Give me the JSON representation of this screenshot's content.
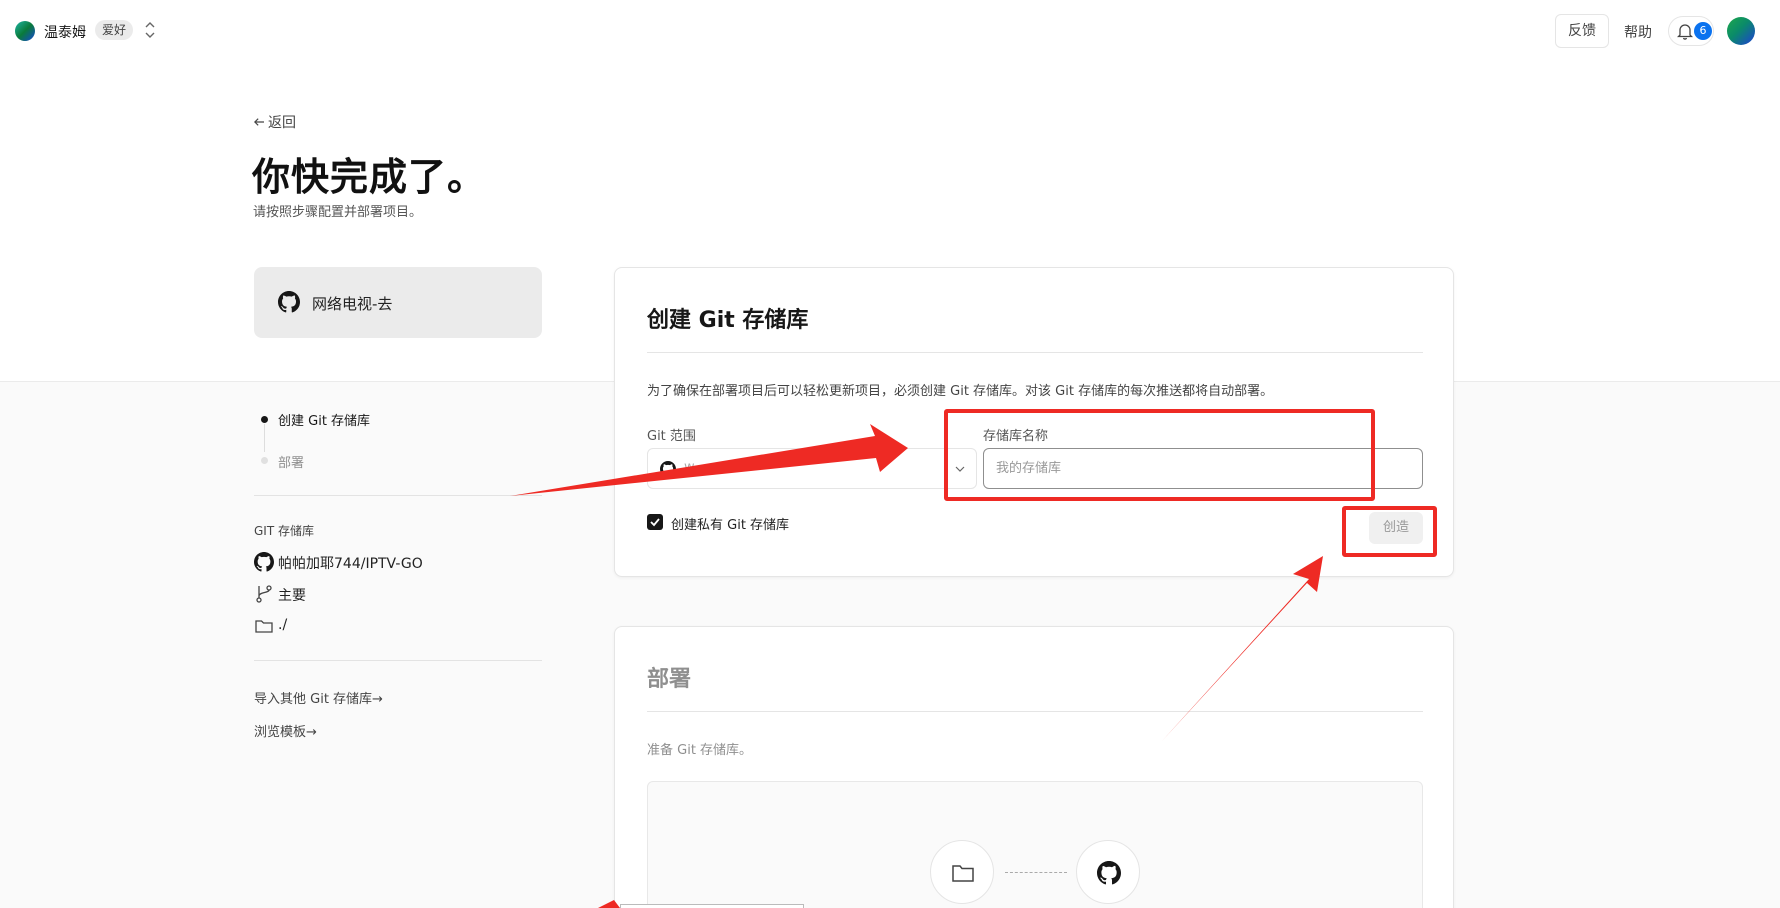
{
  "nav": {
    "team_name": "温泰姆",
    "plan_badge": "爱好",
    "feedback_label": "反馈",
    "help_label": "帮助",
    "notification_count": "6"
  },
  "header": {
    "back_label": "返回",
    "title": "你快完成了。",
    "subtitle": "请按照步骤配置并部署项目。"
  },
  "repo_card": {
    "name": "网络电视-去"
  },
  "steps": [
    {
      "label": "创建 Git 存储库",
      "active": true
    },
    {
      "label": "部署",
      "active": false
    }
  ],
  "git_info": {
    "section_label": "GIT 存储库",
    "repo": "帕帕加耶744/IPTV-GO",
    "branch": "主要",
    "directory": "./"
  },
  "links": {
    "import_other": "导入其他 Git 存储库→",
    "browse_templates": "浏览模板→"
  },
  "create_repo_card": {
    "title": "创建 Git 存储库",
    "description": "为了确保在部署项目后可以轻松更新项目，必须创建 Git 存储库。对该 Git 存储库的每次推送都将自动部署。",
    "scope_label": "Git 范围",
    "scope_value": "w...",
    "name_label": "存储库名称",
    "name_placeholder": "我的存储库",
    "private_label": "创建私有 Git 存储库",
    "private_checked": true,
    "create_button": "创造"
  },
  "deploy_card": {
    "title": "部署",
    "description": "准备 Git 存储库。"
  },
  "colors": {
    "annotation": "#ee2a24",
    "accent": "#0a72ef"
  }
}
